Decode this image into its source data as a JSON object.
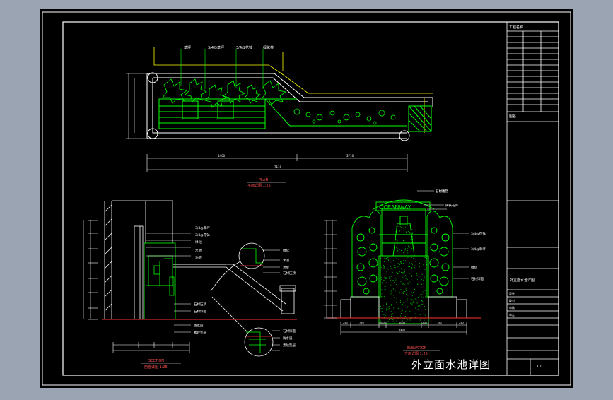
{
  "sheet": {
    "title": "外立面水池详图",
    "background": "#000000",
    "frame_color": "#ffffff",
    "line_green": "#00ff00",
    "line_yellow": "#ffff00",
    "line_red": "#ff0000",
    "line_cyan": "#00ffff"
  },
  "plan_view": {
    "caption_en": "PLAN",
    "caption_cn": "平面详图 1:25",
    "labels": [
      "草坪",
      "3/4@草坪",
      "3/4@花钵",
      "绿化带"
    ],
    "dims": [
      "4400",
      "3710",
      "7110"
    ]
  },
  "section_view": {
    "caption_en": "SECTION",
    "caption_cn": "剖面详图 1:25",
    "labels": [
      "3/4@草坪",
      "3/4@花钵",
      "绿化",
      "水池",
      "池壁",
      "石材压顶",
      "石材饰面",
      "防水层",
      "素砼垫层"
    ],
    "detail_labels": [
      "绿化",
      "水池",
      "池壁",
      "石材压顶",
      "石材饰面",
      "防水层",
      "素砼垫层"
    ]
  },
  "elevation_view": {
    "caption_en": "ELEVATION",
    "caption_cn": "立面详图 1:25",
    "labels": [
      "石材雕塑",
      "铸铁花饰",
      "3/4@花钵",
      "3/4@草坪",
      "绿化",
      "石材饰面"
    ],
    "dims": [
      "250",
      "750",
      "200",
      "1000",
      "200",
      "750",
      "250",
      "3400"
    ]
  },
  "title_block": {
    "project_label": "工程名称",
    "drawing_label": "图名",
    "drawing_name": "外立面水池详图",
    "rows": [
      "设计",
      "校对",
      "审核",
      "审定"
    ],
    "sheet_number": "01"
  }
}
